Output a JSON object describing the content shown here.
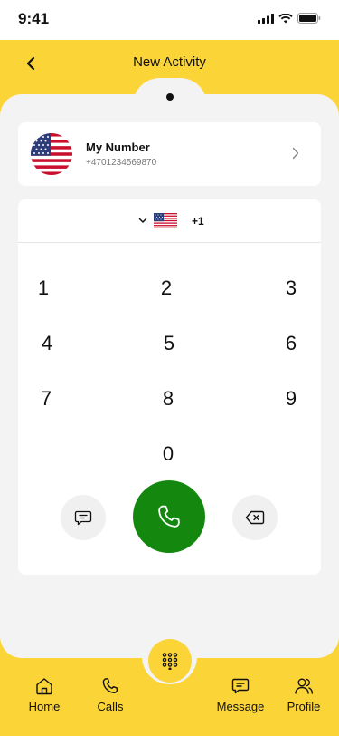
{
  "status_bar": {
    "time": "9:41"
  },
  "header": {
    "title": "New Activity"
  },
  "my_number": {
    "title": "My Number",
    "number": "+4701234569870"
  },
  "dialer": {
    "country_code": "+1",
    "keys": [
      "1",
      "2",
      "3",
      "4",
      "5",
      "6",
      "7",
      "8",
      "9",
      "0"
    ]
  },
  "nav": {
    "home": "Home",
    "calls": "Calls",
    "message": "Message",
    "profile": "Profile"
  },
  "colors": {
    "accent": "#fbd437",
    "call": "#14880e",
    "panel": "#f3f3f3"
  },
  "icons": [
    "back-arrow-icon",
    "us-flag-icon",
    "chevron-right-icon",
    "chevron-down-icon",
    "message-icon",
    "phone-icon",
    "backspace-icon",
    "home-icon",
    "calls-icon",
    "dialpad-icon",
    "profile-icon"
  ]
}
